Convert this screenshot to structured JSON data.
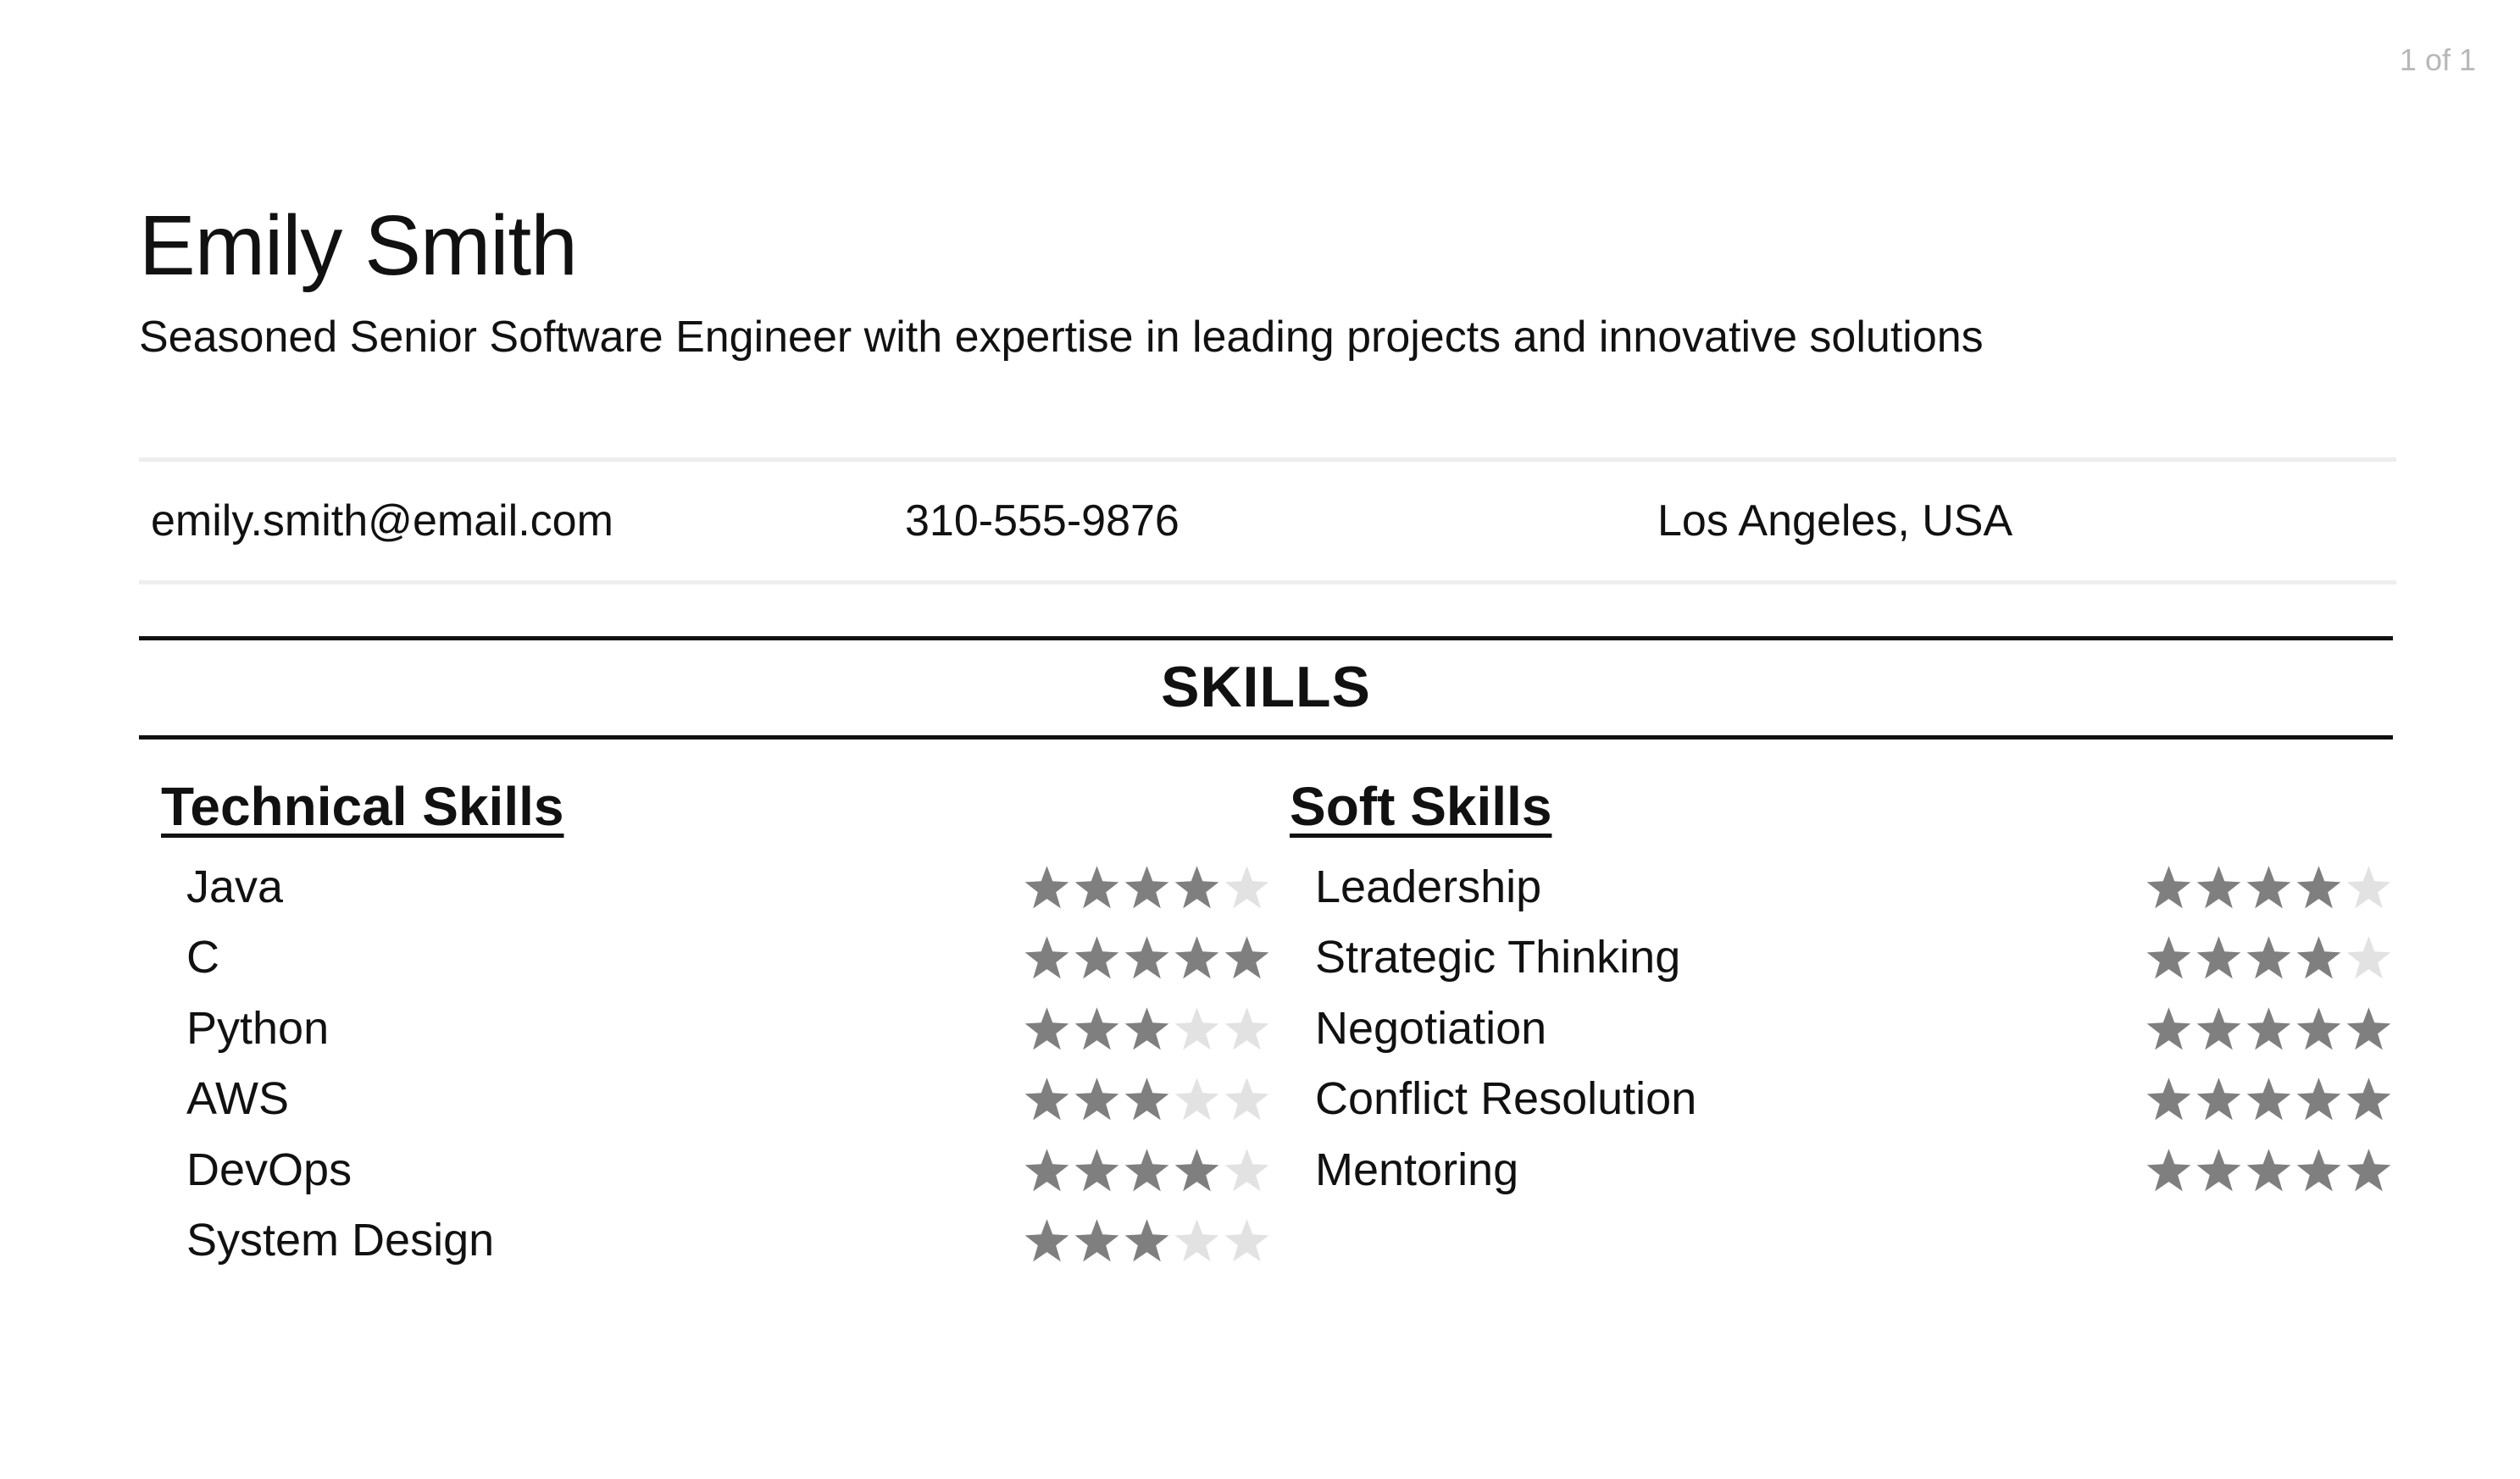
{
  "page_counter": "1 of 1",
  "header": {
    "name": "Emily Smith",
    "tagline": "Seasoned Senior Software Engineer with expertise in leading projects and innovative solutions"
  },
  "contact": {
    "email": "emily.smith@email.com",
    "phone": "310-555-9876",
    "location": "Los Angeles, USA"
  },
  "skills": {
    "section_title": "SKILLS",
    "max_rating": 5,
    "colors": {
      "filled_star": "#7f7f7f",
      "empty_star": "#e2e2e2"
    },
    "technical": {
      "title": "Technical Skills",
      "items": [
        {
          "name": "Java",
          "rating": 4
        },
        {
          "name": "C",
          "rating": 5
        },
        {
          "name": "Python",
          "rating": 3
        },
        {
          "name": "AWS",
          "rating": 3
        },
        {
          "name": "DevOps",
          "rating": 4
        },
        {
          "name": "System Design",
          "rating": 3
        }
      ]
    },
    "soft": {
      "title": "Soft Skills",
      "items": [
        {
          "name": "Leadership",
          "rating": 4
        },
        {
          "name": "Strategic Thinking",
          "rating": 4
        },
        {
          "name": "Negotiation",
          "rating": 5
        },
        {
          "name": "Conflict Resolution",
          "rating": 5
        },
        {
          "name": "Mentoring",
          "rating": 5
        }
      ]
    }
  }
}
